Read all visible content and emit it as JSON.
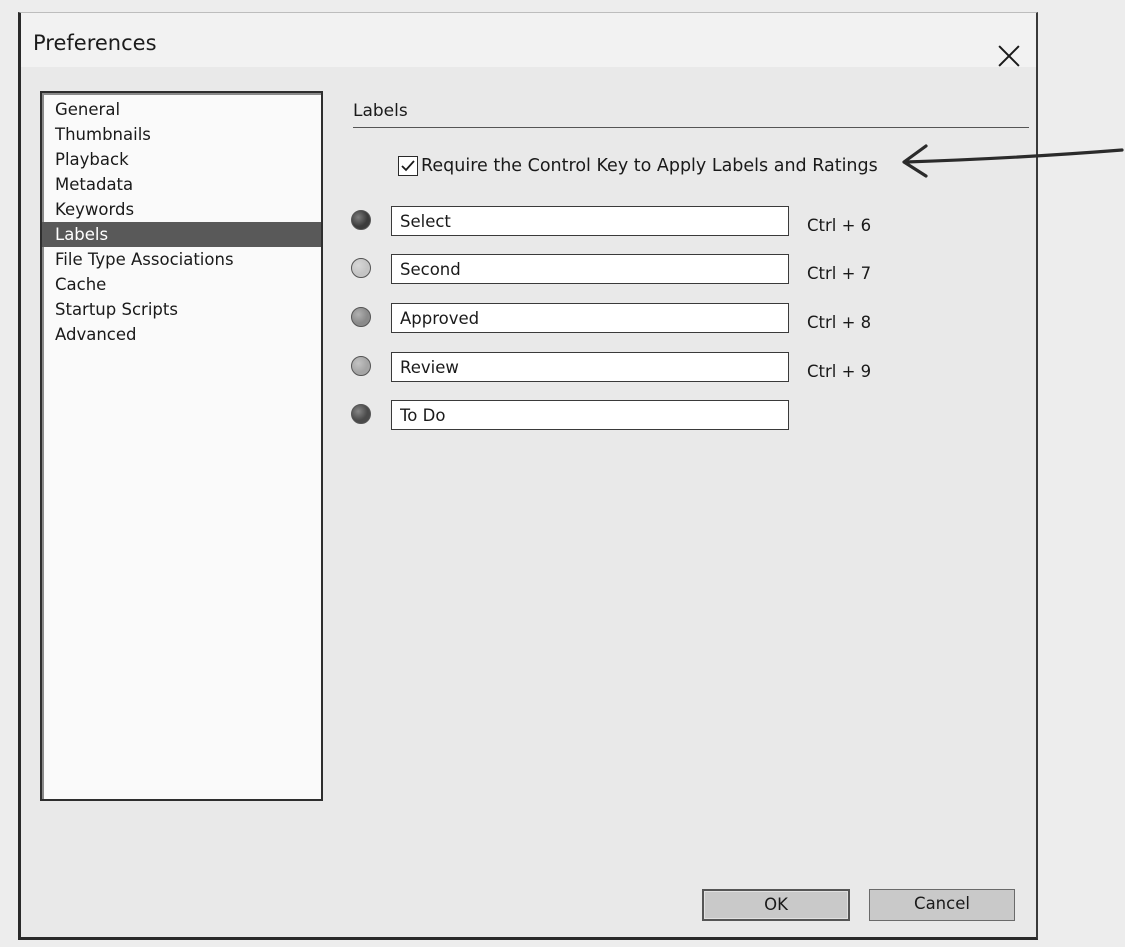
{
  "window": {
    "title": "Preferences",
    "close_icon": "close-icon"
  },
  "sidebar": {
    "items": [
      {
        "label": "General",
        "selected": false
      },
      {
        "label": "Thumbnails",
        "selected": false
      },
      {
        "label": "Playback",
        "selected": false
      },
      {
        "label": "Metadata",
        "selected": false
      },
      {
        "label": "Keywords",
        "selected": false
      },
      {
        "label": "Labels",
        "selected": true
      },
      {
        "label": "File Type Associations",
        "selected": false
      },
      {
        "label": "Cache",
        "selected": false
      },
      {
        "label": "Startup Scripts",
        "selected": false
      },
      {
        "label": "Advanced",
        "selected": false
      }
    ]
  },
  "labels_panel": {
    "header": "Labels",
    "require_ctrl": {
      "label": "Require the Control Key to Apply Labels and Ratings",
      "checked": true
    },
    "rows": [
      {
        "value": "Select",
        "shortcut": "Ctrl + 6",
        "color": "#3c3c3c"
      },
      {
        "value": "Second",
        "shortcut": "Ctrl + 7",
        "color": "#c4c4c4"
      },
      {
        "value": "Approved",
        "shortcut": "Ctrl + 8",
        "color": "#8a8a8a"
      },
      {
        "value": "Review",
        "shortcut": "Ctrl + 9",
        "color": "#a5a5a5"
      },
      {
        "value": "To Do",
        "shortcut": "",
        "color": "#4a4a4a"
      }
    ]
  },
  "buttons": {
    "ok": "OK",
    "cancel": "Cancel"
  },
  "colors": {
    "selection_bg": "#595959",
    "dialog_bg": "#e9e9e9"
  }
}
